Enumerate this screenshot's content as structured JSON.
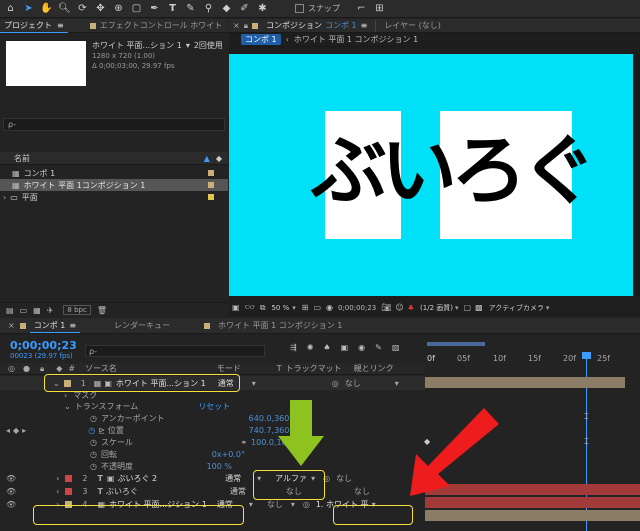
{
  "toolbar": {
    "tools": [
      "home-icon",
      "selection-tool",
      "hand-tool",
      "zoom-tool",
      "orbit-tool",
      "unified-camera-tool",
      "pan-behind-tool",
      "rectangle-tool",
      "pen-tool",
      "text-tool",
      "brush-tool",
      "clone-stamp-tool",
      "eraser-tool",
      "roto-brush-tool",
      "puppet-tool"
    ],
    "snap_label": "スナップ"
  },
  "project": {
    "tab_label": "プロジェクト",
    "effect_tab_label": "エフェクトコントロール ホワイト",
    "item_name": "ホワイト 平面...ション 1",
    "item_usage": "2回使用",
    "item_dims": "1280 x 720 (1.00)",
    "item_duration": "Δ 0;00;03;00, 29.97 fps",
    "search_placeholder": "ρ-",
    "col_name": "名前",
    "items": [
      {
        "name": "コンポ 1",
        "type": "comp",
        "color": "#c9b07a"
      },
      {
        "name": "ホワイト 平面 1コンポジション 1",
        "type": "comp",
        "color": "#c9b07a",
        "selected": true
      },
      {
        "name": "平面",
        "type": "folder",
        "color": "#e0c74e"
      }
    ],
    "bpc": "8 bpc"
  },
  "viewer": {
    "tab_prefix": "コンポジション",
    "tab_label": "コンポ 1",
    "layer_tab": "レイヤー (なし)",
    "crumb1": "コンポ 1",
    "crumb2": "ホワイト 平面 1 コンポジション 1",
    "canvas_color": "#00e1f7",
    "canvas_text": "ぶいろぐ",
    "zoom": "50 %",
    "timecode": "0;00;00;23",
    "resolution": "(1/2 画質)",
    "camera": "アクティブカメラ"
  },
  "timeline": {
    "tab1": "コンポ 1",
    "tab2": "レンダーキュー",
    "tab3": "ホワイト 平面 1 コンポジション 1",
    "timecode": "0;00;00;23",
    "frame_info": "00023 (29.97 fps)",
    "search_placeholder": "ρ-",
    "col_source": "ソース名",
    "col_mode": "モード",
    "col_t": "T",
    "col_trackmatte": "トラックマット",
    "col_parent": "親とリンク",
    "ruler": [
      "0f",
      "05f",
      "10f",
      "15f",
      "20f",
      "25f"
    ],
    "layer1": {
      "num": "1",
      "name": "ホワイト 平面...ション 1",
      "mode": "通常",
      "parent": "なし"
    },
    "mask": "マスク",
    "transform": "トランスフォーム",
    "reset": "リセット",
    "props": [
      {
        "name": "アンカーポイント",
        "value": "640.0,360.0"
      },
      {
        "name": "位置",
        "value": "740.7,360.0"
      },
      {
        "name": "スケール",
        "value": "100.0,100.0%"
      },
      {
        "name": "回転",
        "value": "0x+0.0°"
      },
      {
        "name": "不透明度",
        "value": "100 %"
      }
    ],
    "layer2": {
      "num": "2",
      "name": "ぶいろぐ 2",
      "mode": "通常",
      "matte": "アルファ",
      "parent": "なし"
    },
    "layer3": {
      "num": "3",
      "name": "ぶいろぐ",
      "mode": "通常",
      "matte": "なし",
      "parent": "なし"
    },
    "layer4": {
      "num": "4",
      "name": "ホワイト 平面...ジション 1",
      "mode": "通常",
      "matte": "なし",
      "parent": "1. ホワイト 平"
    }
  },
  "colors": {
    "accent": "#3b9bff",
    "highlight_box": "#f5e13a",
    "arrow_green": "#8dc21f",
    "arrow_red": "#ee1c1c",
    "layer_red": "#a23a3a",
    "layer_tan": "#8c7d66"
  }
}
